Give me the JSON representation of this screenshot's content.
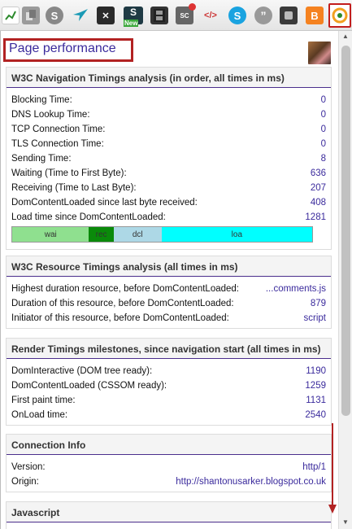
{
  "popup": {
    "title": "Page performance",
    "sections": [
      {
        "heading": "W3C Navigation Timings analysis (in order, all times in ms)",
        "rows": [
          {
            "label": "Blocking Time:",
            "value": "0"
          },
          {
            "label": "DNS Lookup Time:",
            "value": "0"
          },
          {
            "label": "TCP Connection Time:",
            "value": "0"
          },
          {
            "label": "TLS Connection Time:",
            "value": "0"
          },
          {
            "label": "Sending Time:",
            "value": "8"
          },
          {
            "label": "Waiting (Time to First Byte):",
            "value": "636"
          },
          {
            "label": "Receiving (Time to Last Byte):",
            "value": "207"
          },
          {
            "label": "DomContentLoaded since last byte received:",
            "value": "408"
          },
          {
            "label": "Load time since DomContentLoaded:",
            "value": "1281"
          }
        ],
        "timing_bar": [
          {
            "label": "wai",
            "fraction": 0.256,
            "color": "#8fe08f"
          },
          {
            "label": "rec",
            "fraction": 0.082,
            "color": "#0a8a0a"
          },
          {
            "label": "dcl",
            "fraction": 0.16,
            "color": "#add8e6"
          },
          {
            "label": "loa",
            "fraction": 0.502,
            "color": "#00ffff"
          }
        ]
      },
      {
        "heading": "W3C Resource Timings analysis (all times in ms)",
        "rows": [
          {
            "label": "Highest duration resource, before DomContentLoaded:",
            "value": "...comments.js"
          },
          {
            "label": "Duration of this resource, before DomContentLoaded:",
            "value": "879"
          },
          {
            "label": "Initiator of this resource, before DomContentLoaded:",
            "value": "script"
          }
        ]
      },
      {
        "heading": "Render Timings milestones, since navigation start (all times in ms)",
        "rows": [
          {
            "label": "DomInteractive (DOM tree ready):",
            "value": "1190"
          },
          {
            "label": "DomContentLoaded (CSSOM ready):",
            "value": "1259"
          },
          {
            "label": "First paint time:",
            "value": "1131"
          },
          {
            "label": "OnLoad time:",
            "value": "2540"
          }
        ]
      },
      {
        "heading": "Connection Info",
        "rows": [
          {
            "label": "Version:",
            "value": "http/1"
          },
          {
            "label": "Origin:",
            "value": "http://shantonusarker.blogspot.co.uk"
          }
        ]
      },
      {
        "heading": "Javascript",
        "rows": []
      }
    ]
  },
  "toolbar": {
    "icons": [
      "chart-icon",
      "copy-icon",
      "skype-icon",
      "hummingbird-icon",
      "x-icon",
      "s-new-icon",
      "film-icon",
      "sc-icon",
      "code-icon",
      "skype-blue-icon",
      "quote-icon",
      "puzzle-icon",
      "blogger-icon",
      "camera-icon",
      "page-performance-icon"
    ],
    "labels": {
      "s_new": "New",
      "sc": "SC"
    }
  },
  "colors": {
    "accent": "#3a2a9c",
    "heading_rule": "#4b2e8c",
    "title_border": "#b22222",
    "annotation": "#b22222"
  }
}
